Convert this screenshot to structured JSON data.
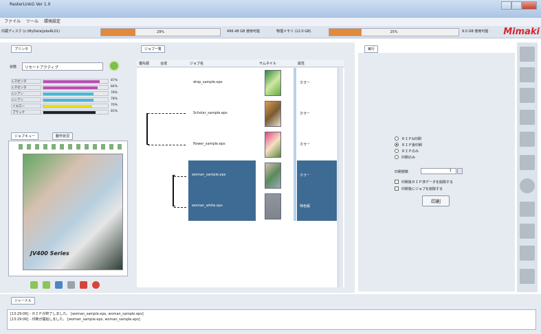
{
  "window": {
    "title": "RasterLinkG Ver 1.0"
  },
  "menu": [
    {
      "label": "ファイル"
    },
    {
      "label": "ツール"
    },
    {
      "label": "環境設定"
    }
  ],
  "statusbar": {
    "disk_label": "内蔵ディスク (c:\\MyData\\JobsRL01)",
    "disk_percent": "29%",
    "disk_fraction": 0.29,
    "disk_used": "496.48 GB 使用可能",
    "mem_label": "物理メモリ (12.0 GB)",
    "mem_percent": "25%",
    "mem_fraction": 0.25,
    "mem_used": "9.0 GB 使用可能",
    "brand": "Mimaki"
  },
  "printer_panel": {
    "tab": "プリンタ",
    "status_label": "状態",
    "status_value": "リモートアクティブ",
    "inks": [
      {
        "name": "Lマゼンタ",
        "level": 0.87,
        "percent": "87%",
        "color": "#b84fb2"
      },
      {
        "name": "Lマゼンタ",
        "level": 0.84,
        "percent": "84%",
        "color": "#b84fb2"
      },
      {
        "name": "Lシアン",
        "level": 0.78,
        "percent": "78%",
        "color": "#4ab6d8"
      },
      {
        "name": "Lシアン",
        "level": 0.78,
        "percent": "78%",
        "color": "#4ab6d8"
      },
      {
        "name": "イエロー",
        "level": 0.76,
        "percent": "76%",
        "color": "#e8e000"
      },
      {
        "name": "ブラック",
        "level": 0.81,
        "percent": "81%",
        "color": "#222222"
      }
    ]
  },
  "queue_panel": {
    "tabs": [
      {
        "label": "ジョブキュー"
      },
      {
        "label": "動作状況"
      }
    ]
  },
  "job_panel": {
    "tab": "ジョブ一覧",
    "columns": [
      "優先順",
      "合成",
      "ジョブ名",
      "サムネイル",
      "属性"
    ],
    "rows": [
      {
        "name": "drop_sample.eps",
        "attribute": "カラー",
        "selected": false
      },
      {
        "name": "Scholar_sample.eps",
        "attribute": "カラー",
        "selected": false
      },
      {
        "name": "flower_sample.eps",
        "attribute": "カラー",
        "selected": false
      },
      {
        "name": "woman_sample.eps",
        "attribute": "カラー",
        "selected": true
      },
      {
        "name": "woman_white.eps",
        "attribute": "特色版",
        "selected": true
      }
    ]
  },
  "exec_panel": {
    "tab": "実行",
    "options": [
      {
        "label": "ＲＩＰ&印刷"
      },
      {
        "label": "ＲＩＰ後印刷"
      },
      {
        "label": "ＲＩＰのみ"
      },
      {
        "label": "印刷のみ"
      }
    ],
    "copies_label": "印刷部数",
    "copies_value": "1",
    "check1": "印刷後ＲＩＰ済データを削除する",
    "check2": "印刷後にジョブを削除する",
    "print_button": "印刷"
  },
  "log_panel": {
    "tab": "ジャーナル",
    "lines": [
      "[13:29:06] - ＲＩＰが終了しました。 [woman_sample.eps, woman_sample.eps]",
      "[13:29:06] - 印刷が開始しました。 [woman_sample.eps, woman_sample.eps]"
    ]
  },
  "preview": {
    "caption": "JV400 Series"
  }
}
